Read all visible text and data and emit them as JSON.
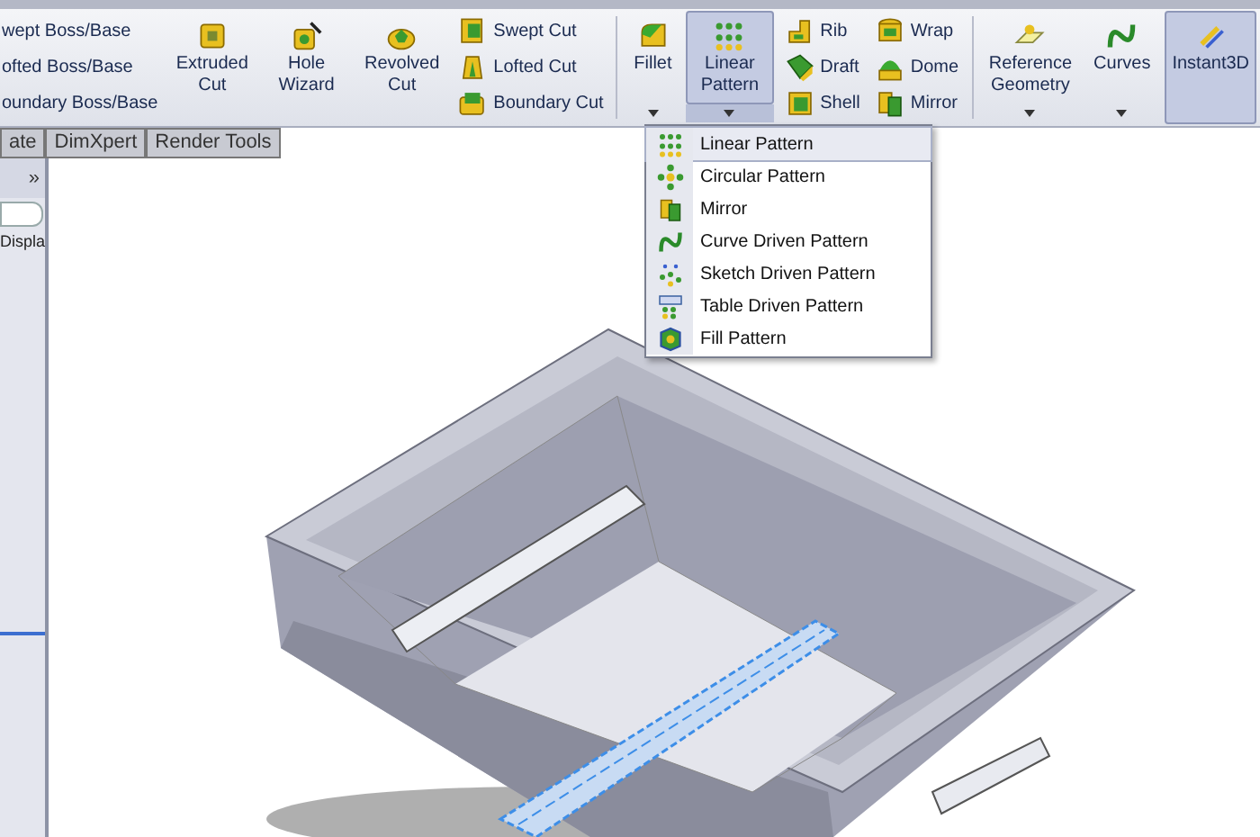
{
  "ribbon": {
    "groups": [
      {
        "kind": "column",
        "items": [
          {
            "label": "wept Boss/Base"
          },
          {
            "label": "ofted Boss/Base"
          },
          {
            "label": "oundary Boss/Base"
          }
        ]
      },
      {
        "kind": "large",
        "label": "Extruded Cut",
        "pressed": false
      },
      {
        "kind": "large",
        "label": "Hole Wizard",
        "pressed": false
      },
      {
        "kind": "large",
        "label": "Revolved Cut",
        "pressed": false
      },
      {
        "kind": "column",
        "items": [
          {
            "label": "Swept Cut"
          },
          {
            "label": "Lofted Cut"
          },
          {
            "label": "Boundary Cut"
          }
        ]
      },
      {
        "kind": "divider"
      },
      {
        "kind": "split",
        "label": "Fillet",
        "pressed": false
      },
      {
        "kind": "split",
        "label": "Linear Pattern",
        "pressed": true
      },
      {
        "kind": "column",
        "items": [
          {
            "label": "Rib"
          },
          {
            "label": "Draft"
          },
          {
            "label": "Shell"
          }
        ]
      },
      {
        "kind": "column",
        "items": [
          {
            "label": "Wrap"
          },
          {
            "label": "Dome"
          },
          {
            "label": "Mirror"
          }
        ]
      },
      {
        "kind": "divider"
      },
      {
        "kind": "split",
        "label": "Reference Geometry",
        "pressed": false
      },
      {
        "kind": "split",
        "label": "Curves",
        "pressed": false
      },
      {
        "kind": "large",
        "label": "Instant3D",
        "pressed": true
      }
    ]
  },
  "tabs": [
    {
      "label": "ate",
      "selected": false
    },
    {
      "label": "DimXpert",
      "selected": false
    },
    {
      "label": "Render Tools",
      "selected": false
    }
  ],
  "side_panel": {
    "expand": "»",
    "label": "Displa"
  },
  "pattern_menu": [
    {
      "label": "Linear Pattern",
      "selected": true
    },
    {
      "label": "Circular Pattern",
      "selected": false
    },
    {
      "label": "Mirror",
      "selected": false
    },
    {
      "label": "Curve Driven Pattern",
      "selected": false
    },
    {
      "label": "Sketch Driven Pattern",
      "selected": false
    },
    {
      "label": "Table Driven Pattern",
      "selected": false
    },
    {
      "label": "Fill Pattern",
      "selected": false
    }
  ]
}
